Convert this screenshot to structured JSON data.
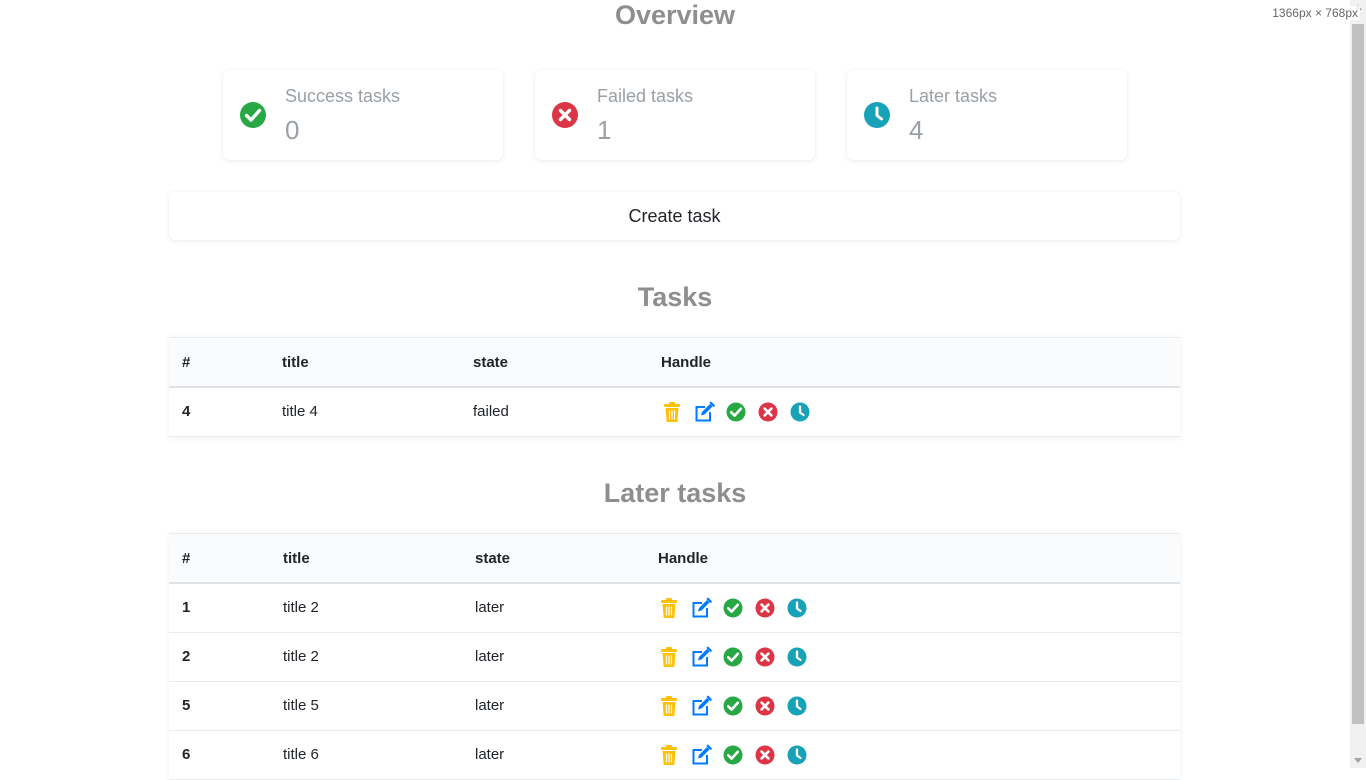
{
  "viewport_label": "1366px × 768px",
  "overview": {
    "title": "Overview",
    "cards": [
      {
        "label": "Success tasks",
        "value": "0",
        "icon": "check-circle-icon",
        "color": "#28a745"
      },
      {
        "label": "Failed tasks",
        "value": "1",
        "icon": "times-circle-icon",
        "color": "#dc3545"
      },
      {
        "label": "Later tasks",
        "value": "4",
        "icon": "clock-icon",
        "color": "#17a2b8"
      }
    ]
  },
  "create_button": {
    "label": "Create task"
  },
  "tasks": {
    "title": "Tasks",
    "headers": [
      "#",
      "title",
      "state",
      "Handle"
    ],
    "rows": [
      {
        "id": "4",
        "title": "title 4",
        "state": "failed"
      }
    ]
  },
  "later_tasks": {
    "title": "Later tasks",
    "headers": [
      "#",
      "title",
      "state",
      "Handle"
    ],
    "rows": [
      {
        "id": "1",
        "title": "title 2",
        "state": "later"
      },
      {
        "id": "2",
        "title": "title 2",
        "state": "later"
      },
      {
        "id": "5",
        "title": "title 5",
        "state": "later"
      },
      {
        "id": "6",
        "title": "title 6",
        "state": "later"
      }
    ]
  },
  "handle_actions": [
    {
      "icon": "trash-icon",
      "color": "#ffc107"
    },
    {
      "icon": "edit-icon",
      "color": "#007bff"
    },
    {
      "icon": "check-circle-icon",
      "color": "#28a745"
    },
    {
      "icon": "times-circle-icon",
      "color": "#dc3545"
    },
    {
      "icon": "clock-icon",
      "color": "#17a2b8"
    }
  ]
}
